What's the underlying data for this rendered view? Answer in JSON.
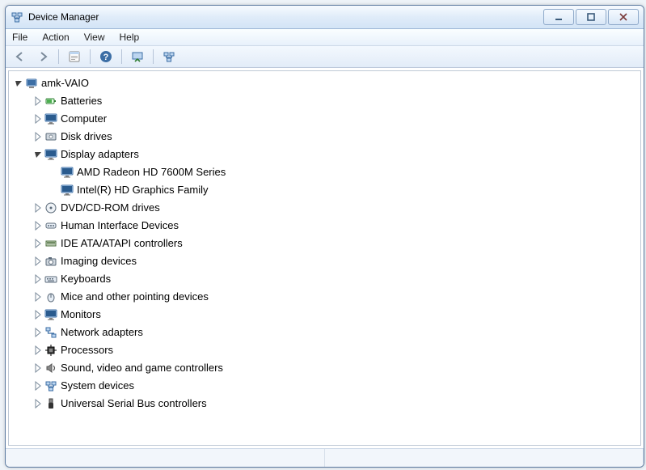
{
  "window": {
    "title": "Device Manager"
  },
  "menu": {
    "file": "File",
    "action": "Action",
    "view": "View",
    "help": "Help"
  },
  "tree": {
    "root": "amk-VAIO",
    "cat": {
      "batteries": "Batteries",
      "computer": "Computer",
      "disk_drives": "Disk drives",
      "display_adapters": "Display adapters",
      "dvd": "DVD/CD-ROM drives",
      "hid": "Human Interface Devices",
      "ide": "IDE ATA/ATAPI controllers",
      "imaging": "Imaging devices",
      "keyboards": "Keyboards",
      "mice": "Mice and other pointing devices",
      "monitors": "Monitors",
      "network": "Network adapters",
      "processors": "Processors",
      "sound": "Sound, video and game controllers",
      "system": "System devices",
      "usb": "Universal Serial Bus controllers"
    },
    "display_children": {
      "amd": "AMD Radeon HD 7600M Series",
      "intel": "Intel(R) HD Graphics Family"
    }
  }
}
